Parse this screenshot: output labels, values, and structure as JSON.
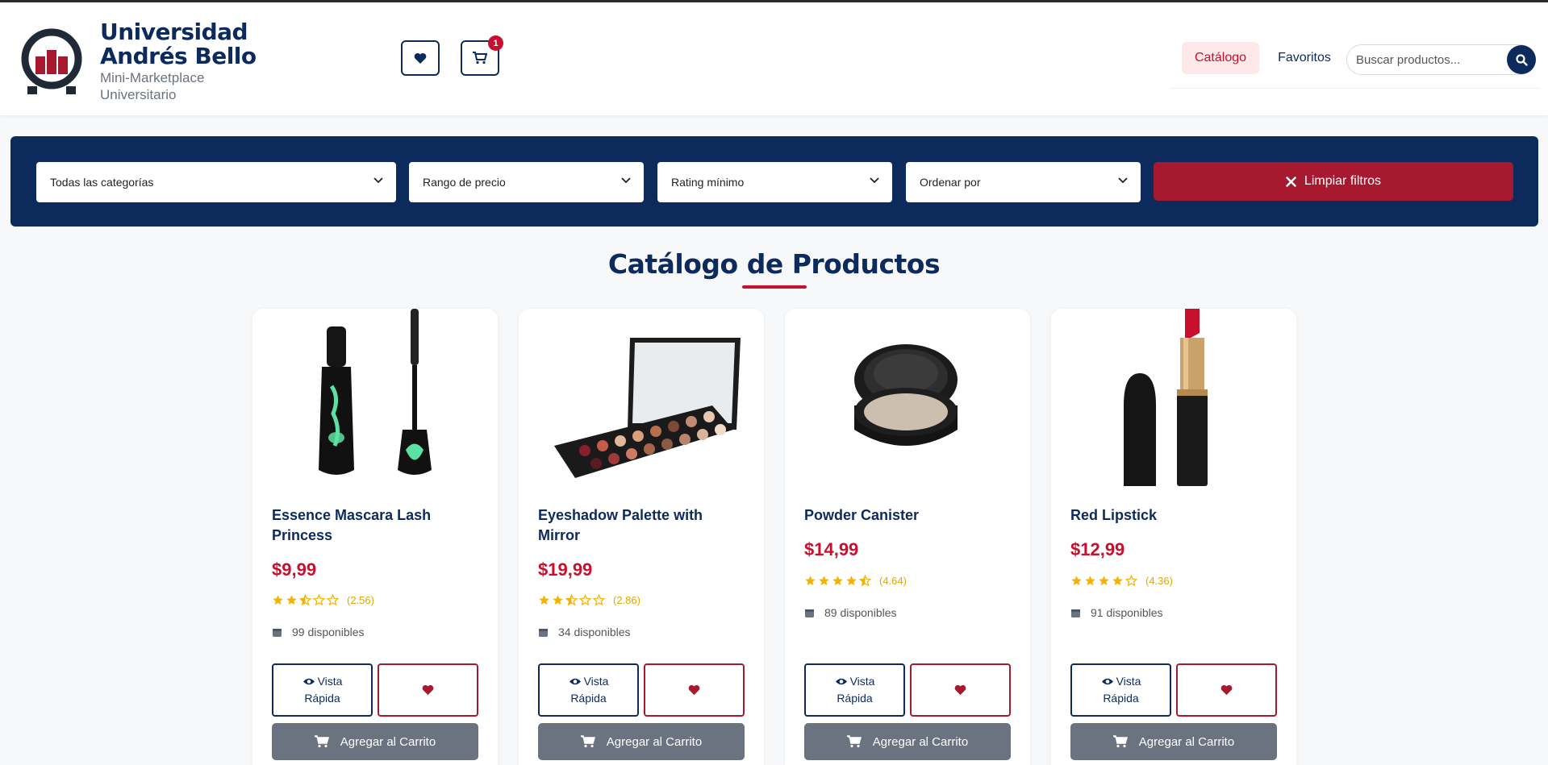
{
  "header": {
    "brand_title_line1": "Universidad",
    "brand_title_line2": "Andrés Bello",
    "brand_sub_line1": "Mini-Marketplace",
    "brand_sub_line2": "Universitario",
    "cart_count": "1",
    "nav": {
      "catalogo": "Catálogo",
      "favoritos": "Favoritos"
    },
    "search_placeholder": "Buscar productos..."
  },
  "filters": {
    "category": "Todas las categorías",
    "price": "Rango de precio",
    "rating": "Rating mínimo",
    "order": "Ordenar por",
    "clear_label": "Limpiar filtros"
  },
  "catalog": {
    "title": "Catálogo de Productos",
    "products": [
      {
        "name": "Essence Mascara Lash Princess",
        "price": "$9,99",
        "rating": 2.56,
        "rating_text": "(2.56)",
        "stock": "99 disponibles",
        "image_icon": "mascara-image"
      },
      {
        "name": "Eyeshadow Palette with Mirror",
        "price": "$19,99",
        "rating": 2.86,
        "rating_text": "(2.86)",
        "stock": "34 disponibles",
        "image_icon": "eyeshadow-palette-image"
      },
      {
        "name": "Powder Canister",
        "price": "$14,99",
        "rating": 4.64,
        "rating_text": "(4.64)",
        "stock": "89 disponibles",
        "image_icon": "powder-compact-image"
      },
      {
        "name": "Red Lipstick",
        "price": "$12,99",
        "rating": 4.36,
        "rating_text": "(4.36)",
        "stock": "91 disponibles",
        "image_icon": "lipstick-image"
      }
    ],
    "buttons": {
      "vista_line1": "Vista",
      "vista_line2": "Rápida",
      "add_to_cart": "Agregar al Carrito"
    }
  },
  "colors": {
    "navy": "#0d2a5c",
    "accent": "#c8102e",
    "gray_button": "#6b7280"
  }
}
